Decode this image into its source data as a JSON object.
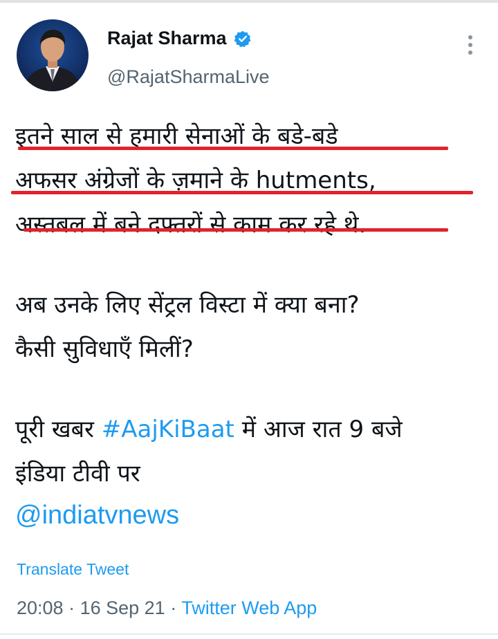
{
  "author": {
    "name": "Rajat Sharma",
    "handle": "@RajatSharmaLive",
    "verified": true,
    "avatar_icon": "profile-photo"
  },
  "tweet": {
    "lines": [
      "इतने साल से हमारी सेनाओं के बडे-बडे",
      "अफसर अंग्रेजों के ज़माने के hutments,",
      "अस्तबल में बने दफ्तरों से काम कर रहे थे."
    ],
    "question_lines": [
      "अब उनके लिए सेंट्रल विस्टा में क्या बना?",
      "कैसी सुविधाएँ मिलीं?"
    ],
    "promo_prefix": "पूरी खबर ",
    "hashtag": "#AajKiBaat",
    "promo_suffix": " में आज रात 9 बजे",
    "promo_line2": "इंडिया टीवी पर",
    "mention": "@indiatvnews"
  },
  "translate_label": "Translate Tweet",
  "meta": {
    "time": "20:08",
    "separator": " · ",
    "date": "16 Sep 21",
    "source": "Twitter Web App"
  },
  "colors": {
    "link": "#1d9bf0",
    "underline": "#e0242b",
    "secondary_text": "#536471"
  }
}
